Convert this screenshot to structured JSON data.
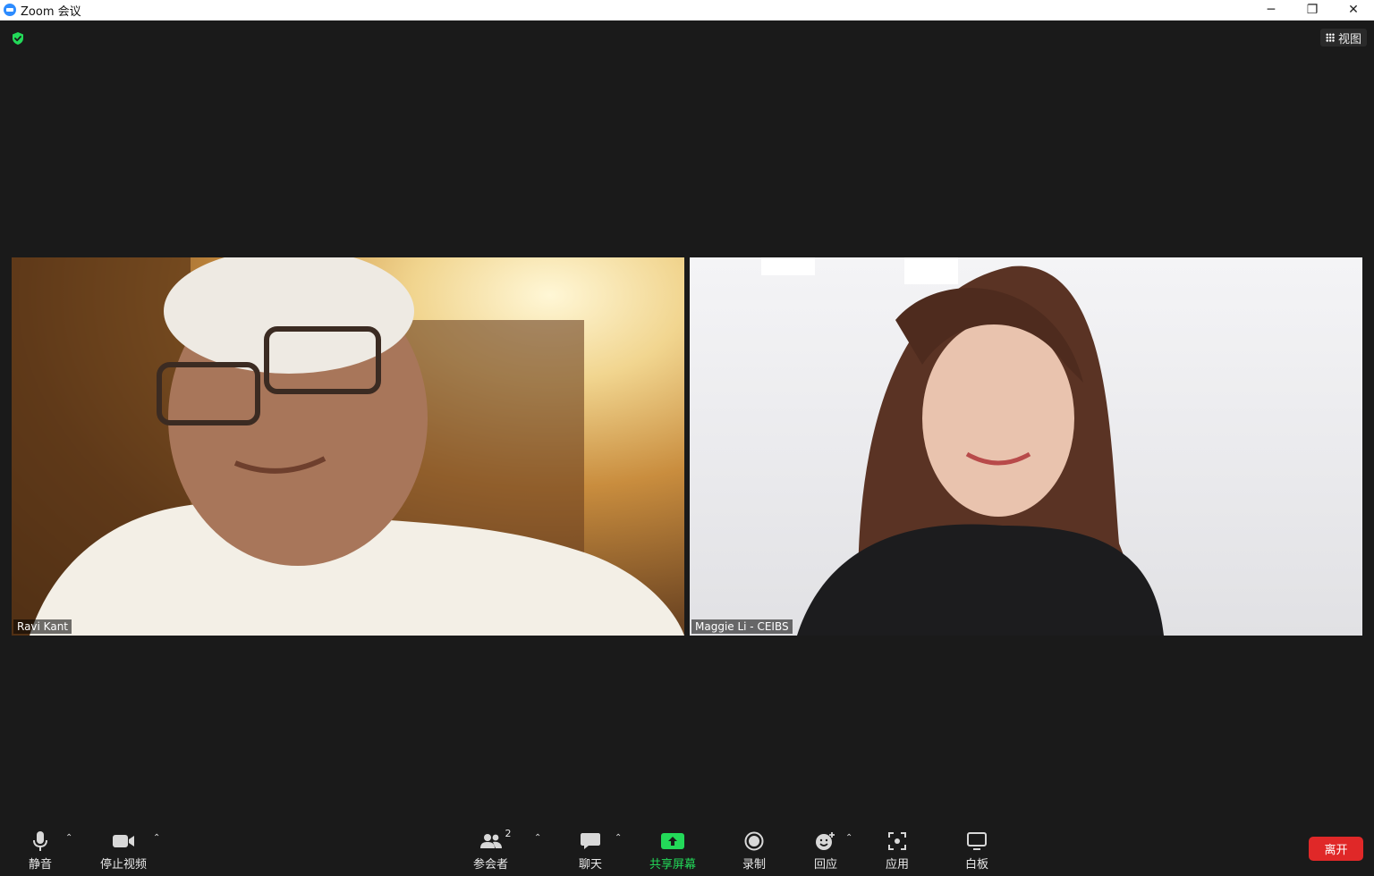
{
  "window": {
    "title": "Zoom 会议",
    "minimize_glyph": "─",
    "restore_glyph": "❐",
    "close_glyph": "✕"
  },
  "top": {
    "security_icon": "shield-check-icon",
    "view_label": "视图"
  },
  "participants": [
    {
      "name": "Ravi Kant"
    },
    {
      "name": "Maggie Li - CEIBS"
    }
  ],
  "toolbar": {
    "mute_label": "静音",
    "video_label": "停止视频",
    "participants_label": "参会者",
    "participants_count": "2",
    "chat_label": "聊天",
    "share_label": "共享屏幕",
    "record_label": "录制",
    "reactions_label": "回应",
    "apps_label": "应用",
    "whiteboard_label": "白板",
    "leave_label": "离开",
    "caret": "⌃"
  },
  "colors": {
    "background": "#1a1a1a",
    "share_green": "#23d959",
    "leave_red": "#e02828",
    "shield_green": "#23d959"
  }
}
